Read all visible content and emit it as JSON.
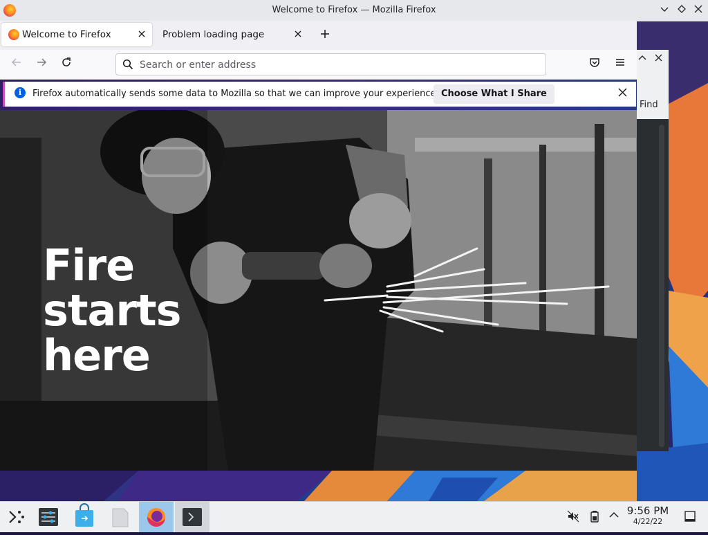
{
  "window": {
    "title": "Welcome to Firefox — Mozilla Firefox",
    "controls": [
      "minimize",
      "maximize",
      "close"
    ]
  },
  "tabs": [
    {
      "label": "Welcome to Firefox",
      "active": true,
      "icon": "firefox-icon"
    },
    {
      "label": "Problem loading page",
      "active": false
    }
  ],
  "navbar": {
    "back_icon": "back-arrow-icon",
    "forward_icon": "forward-arrow-icon",
    "reload_icon": "reload-icon",
    "search_placeholder": "Search or enter address",
    "search_value": "",
    "pocket_icon": "pocket-icon",
    "menu_icon": "hamburger-menu-icon"
  },
  "notification": {
    "message": "Firefox automatically sends some data to Mozilla so that we can improve your experience.",
    "button_label": "Choose What I Share",
    "accent_color": "#c750c0"
  },
  "hero": {
    "headline_lines": [
      "Fire",
      "starts",
      "here"
    ]
  },
  "side_panel": {
    "find_label": "Find"
  },
  "taskbar": {
    "items": [
      {
        "name": "application-launcher-icon"
      },
      {
        "name": "system-settings-icon"
      },
      {
        "name": "discover-store-icon"
      },
      {
        "name": "file-manager-icon"
      },
      {
        "name": "firefox-icon",
        "active": true
      },
      {
        "name": "terminal-icon",
        "running": true
      }
    ],
    "tray": [
      "audio-muted-icon",
      "battery-icon",
      "tray-expand-icon",
      "show-desktop-icon"
    ],
    "time": "9:56 PM",
    "date": "4/22/22",
    "active_color": "#9bc7ea"
  }
}
